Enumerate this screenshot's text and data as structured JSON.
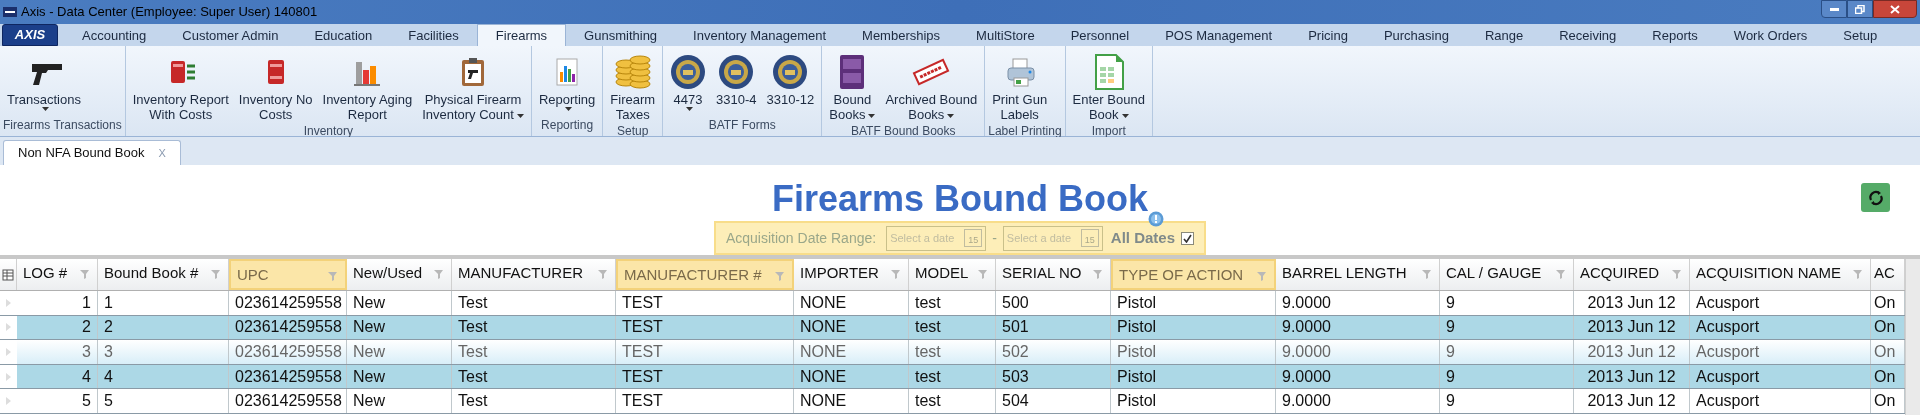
{
  "window": {
    "title": "Axis - Data Center  (Employee: Super User) 140801"
  },
  "menu": {
    "logo": "AXIS",
    "tabs": [
      {
        "label": "Accounting",
        "selected": false
      },
      {
        "label": "Customer Admin",
        "selected": false
      },
      {
        "label": "Education",
        "selected": false
      },
      {
        "label": "Facilities",
        "selected": false
      },
      {
        "label": "Firearms",
        "selected": true
      },
      {
        "label": "Gunsmithing",
        "selected": false
      },
      {
        "label": "Inventory Management",
        "selected": false
      },
      {
        "label": "Memberships",
        "selected": false
      },
      {
        "label": "MultiStore",
        "selected": false
      },
      {
        "label": "Personnel",
        "selected": false
      },
      {
        "label": "POS Management",
        "selected": false
      },
      {
        "label": "Pricing",
        "selected": false
      },
      {
        "label": "Purchasing",
        "selected": false
      },
      {
        "label": "Range",
        "selected": false
      },
      {
        "label": "Receiving",
        "selected": false
      },
      {
        "label": "Reports",
        "selected": false
      },
      {
        "label": "Work Orders",
        "selected": false
      },
      {
        "label": "Setup",
        "selected": false
      }
    ]
  },
  "ribbon": {
    "groups": [
      {
        "label": "Firearms Transactions",
        "buttons": [
          {
            "lines": [
              "Transactions"
            ],
            "dropdown": true
          }
        ]
      },
      {
        "label": "Inventory",
        "buttons": [
          {
            "lines": [
              "Inventory Report",
              "With Costs"
            ],
            "dropdown": false
          },
          {
            "lines": [
              "Inventory No",
              "Costs"
            ],
            "dropdown": false
          },
          {
            "lines": [
              "Inventory Aging",
              "Report"
            ],
            "dropdown": false
          },
          {
            "lines": [
              "Physical Firearm",
              "Inventory Count"
            ],
            "dropdown": true
          }
        ]
      },
      {
        "label": "Reporting",
        "buttons": [
          {
            "lines": [
              "Reporting"
            ],
            "dropdown": true
          }
        ]
      },
      {
        "label": "Setup",
        "buttons": [
          {
            "lines": [
              "Firearm",
              "Taxes"
            ],
            "dropdown": false
          }
        ]
      },
      {
        "label": "BATF Forms",
        "buttons": [
          {
            "lines": [
              "4473"
            ],
            "dropdown": true
          },
          {
            "lines": [
              "3310-4"
            ],
            "dropdown": false
          },
          {
            "lines": [
              "3310-12"
            ],
            "dropdown": false
          }
        ]
      },
      {
        "label": "BATF Bound Books",
        "buttons": [
          {
            "lines": [
              "Bound",
              "Books"
            ],
            "dropdown": true
          },
          {
            "lines": [
              "Archived Bound",
              "Books"
            ],
            "dropdown": true
          }
        ]
      },
      {
        "label": "Label Printing",
        "buttons": [
          {
            "lines": [
              "Print Gun",
              "Labels"
            ],
            "dropdown": false
          }
        ]
      },
      {
        "label": "Import",
        "buttons": [
          {
            "lines": [
              "Enter Bound",
              "Book"
            ],
            "dropdown": true
          }
        ]
      }
    ]
  },
  "document_tabs": [
    {
      "label": "Non NFA Bound Book",
      "close": "X",
      "selected": true
    }
  ],
  "page": {
    "title": "Firearms Bound Book",
    "date_filter": {
      "label": "Acquisition Date Range:",
      "highlighted": true,
      "from": {
        "placeholder": "Select a date",
        "calendar_day": "15"
      },
      "separator": "-",
      "to": {
        "placeholder": "Select a date",
        "calendar_day": "15"
      },
      "all_dates": {
        "label": "All Dates",
        "checked": true
      }
    }
  },
  "table": {
    "columns": [
      {
        "label": "LOG #",
        "highlighted": false
      },
      {
        "label": "Bound Book #",
        "highlighted": false
      },
      {
        "label": "UPC",
        "highlighted": true
      },
      {
        "label": "New/Used",
        "highlighted": false
      },
      {
        "label": "MANUFACTURER",
        "highlighted": false
      },
      {
        "label": "MANUFACTURER #",
        "highlighted": true
      },
      {
        "label": "IMPORTER",
        "highlighted": false
      },
      {
        "label": "MODEL",
        "highlighted": false
      },
      {
        "label": "SERIAL NO",
        "highlighted": false
      },
      {
        "label": "TYPE OF ACTION",
        "highlighted": true
      },
      {
        "label": "BARREL LENGTH",
        "highlighted": false
      },
      {
        "label": "CAL / GAUGE",
        "highlighted": false
      },
      {
        "label": "ACQUIRED",
        "highlighted": false
      },
      {
        "label": "ACQUISITION NAME",
        "highlighted": false
      },
      {
        "label": "AC",
        "highlighted": false
      }
    ],
    "rows": [
      {
        "selected": false,
        "hover": false,
        "cells": [
          "1",
          "1",
          "023614259558",
          "New",
          "Test",
          "TEST",
          "NONE",
          "test",
          "500",
          "Pistol",
          "9.0000",
          "9",
          "2013 Jun 12",
          "Acusport",
          "On"
        ]
      },
      {
        "selected": true,
        "hover": false,
        "cells": [
          "2",
          "2",
          "023614259558",
          "New",
          "Test",
          "TEST",
          "NONE",
          "test",
          "501",
          "Pistol",
          "9.0000",
          "9",
          "2013 Jun 12",
          "Acusport",
          "On"
        ]
      },
      {
        "selected": false,
        "hover": true,
        "cells": [
          "3",
          "3",
          "023614259558",
          "New",
          "Test",
          "TEST",
          "NONE",
          "test",
          "502",
          "Pistol",
          "9.0000",
          "9",
          "2013 Jun 12",
          "Acusport",
          "On"
        ]
      },
      {
        "selected": true,
        "hover": false,
        "cells": [
          "4",
          "4",
          "023614259558",
          "New",
          "Test",
          "TEST",
          "NONE",
          "test",
          "503",
          "Pistol",
          "9.0000",
          "9",
          "2013 Jun 12",
          "Acusport",
          "On"
        ]
      },
      {
        "selected": false,
        "hover": false,
        "cells": [
          "5",
          "5",
          "023614259558",
          "New",
          "Test",
          "TEST",
          "NONE",
          "test",
          "504",
          "Pistol",
          "9.0000",
          "9",
          "2013 Jun 12",
          "Acusport",
          "On"
        ]
      }
    ]
  }
}
